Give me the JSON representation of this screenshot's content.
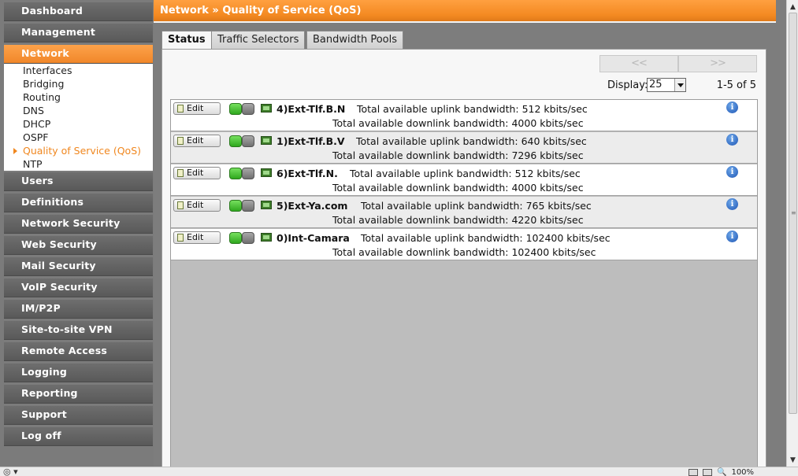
{
  "sidebar": {
    "menu": [
      {
        "label": "Dashboard",
        "active": false
      },
      {
        "label": "Management",
        "active": false
      },
      {
        "label": "Network",
        "active": true
      },
      {
        "label": "Users",
        "active": false
      },
      {
        "label": "Definitions",
        "active": false
      },
      {
        "label": "Network Security",
        "active": false
      },
      {
        "label": "Web Security",
        "active": false
      },
      {
        "label": "Mail Security",
        "active": false
      },
      {
        "label": "VoIP Security",
        "active": false
      },
      {
        "label": "IM/P2P",
        "active": false
      },
      {
        "label": "Site-to-site VPN",
        "active": false
      },
      {
        "label": "Remote Access",
        "active": false
      },
      {
        "label": "Logging",
        "active": false
      },
      {
        "label": "Reporting",
        "active": false
      },
      {
        "label": "Support",
        "active": false
      },
      {
        "label": "Log off",
        "active": false
      }
    ],
    "submenu": [
      {
        "label": "Interfaces",
        "active": false
      },
      {
        "label": "Bridging",
        "active": false
      },
      {
        "label": "Routing",
        "active": false
      },
      {
        "label": "DNS",
        "active": false
      },
      {
        "label": "DHCP",
        "active": false
      },
      {
        "label": "OSPF",
        "active": false
      },
      {
        "label": "Quality of Service (QoS)",
        "active": true
      },
      {
        "label": "NTP",
        "active": false
      }
    ]
  },
  "header": {
    "breadcrumb": "Network » Quality of Service (QoS)"
  },
  "tabs": [
    {
      "label": "Status",
      "active": true
    },
    {
      "label": "Traffic Selectors",
      "active": false
    },
    {
      "label": "Bandwidth Pools",
      "active": false
    }
  ],
  "pager": {
    "prev_label": "<<",
    "next_label": ">>",
    "display_label": "Display:",
    "display_value": "25",
    "range_label": "1-5 of 5"
  },
  "rows": [
    {
      "edit_label": "Edit",
      "name": "4)Ext-Tlf.B.N",
      "uplink": "Total available uplink bandwidth: 512 kbits/sec",
      "downlink": "Total available downlink bandwidth: 4000 kbits/sec"
    },
    {
      "edit_label": "Edit",
      "name": "1)Ext-Tlf.B.V",
      "uplink": "Total available uplink bandwidth: 640 kbits/sec",
      "downlink": "Total available downlink bandwidth: 7296 kbits/sec"
    },
    {
      "edit_label": "Edit",
      "name": "6)Ext-Tlf.N.",
      "uplink": "Total available uplink bandwidth: 512 kbits/sec",
      "downlink": "Total available downlink bandwidth: 4000 kbits/sec"
    },
    {
      "edit_label": "Edit",
      "name": "5)Ext-Ya.com",
      "uplink": "Total available uplink bandwidth: 765 kbits/sec",
      "downlink": "Total available downlink bandwidth: 4220 kbits/sec"
    },
    {
      "edit_label": "Edit",
      "name": "0)Int-Camara",
      "uplink": "Total available uplink bandwidth: 102400 kbits/sec",
      "downlink": "Total available downlink bandwidth: 102400 kbits/sec"
    }
  ],
  "statusbar": {
    "zoom": "100%"
  },
  "colors": {
    "accent_orange": "#f48a22",
    "sidebar_gray": "#6e6e6e",
    "active_green": "#2fa81e",
    "info_blue": "#1e55b4"
  }
}
